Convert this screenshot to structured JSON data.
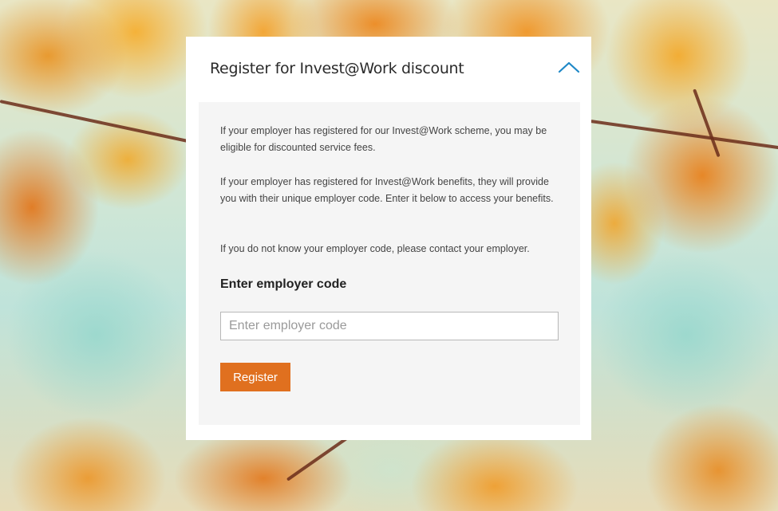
{
  "panel": {
    "title": "Register for Invest@Work discount",
    "collapse_icon": "chevron-up-icon",
    "accent_color": "#1e88c7"
  },
  "body": {
    "paragraphs": [
      "If your employer has registered for our Invest@Work scheme, you may be eligible for discounted service fees.",
      "If your employer has registered for Invest@Work benefits, they will provide you with their unique employer code. Enter it below to access your benefits.",
      "If you do not know your employer code, please contact your employer."
    ],
    "field_label": "Enter employer code",
    "input": {
      "value": "",
      "placeholder": "Enter employer code"
    },
    "register_label": "Register",
    "register_color": "#e0701f"
  }
}
